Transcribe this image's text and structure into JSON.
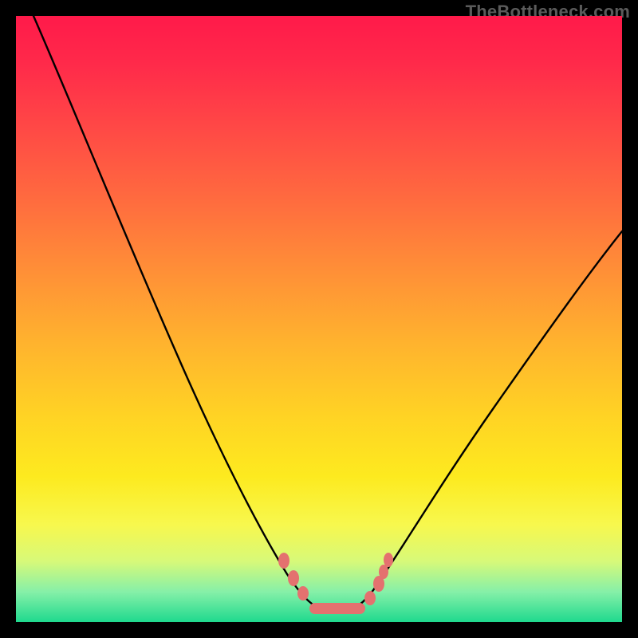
{
  "watermark": "TheBottleneck.com",
  "chart_data": {
    "type": "line",
    "title": "",
    "xlabel": "",
    "ylabel": "",
    "xlim": [
      0,
      100
    ],
    "ylim": [
      0,
      100
    ],
    "grid": false,
    "legend": false,
    "background": "rainbow-gradient-vertical",
    "series": [
      {
        "name": "bottleneck-curve",
        "color": "#000000",
        "x": [
          3,
          10,
          18,
          26,
          32,
          38,
          43,
          46,
          48,
          50,
          53,
          56,
          59,
          63,
          68,
          74,
          82,
          90,
          98
        ],
        "y": [
          100,
          85,
          69,
          53,
          40,
          28,
          18,
          10,
          5,
          2,
          2,
          4,
          8,
          14,
          22,
          31,
          42,
          52,
          61
        ]
      }
    ],
    "markers": {
      "name": "highlight-dots",
      "color": "#e4716f",
      "points": [
        {
          "x": 44,
          "y": 11
        },
        {
          "x": 46,
          "y": 7
        },
        {
          "x": 48,
          "y": 4
        },
        {
          "x": 50,
          "y": 3
        },
        {
          "x": 52,
          "y": 3
        },
        {
          "x": 54,
          "y": 3
        },
        {
          "x": 56,
          "y": 4
        },
        {
          "x": 58,
          "y": 6
        },
        {
          "x": 60,
          "y": 9
        },
        {
          "x": 61,
          "y": 12
        }
      ]
    }
  }
}
